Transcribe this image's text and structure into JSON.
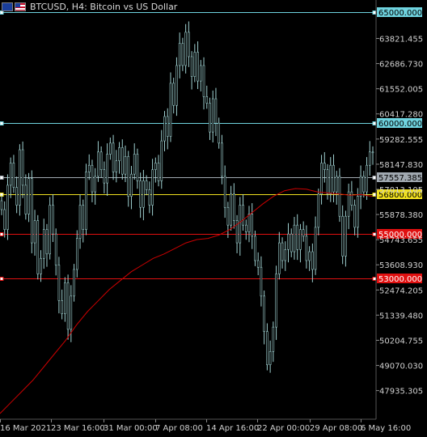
{
  "header": {
    "title": "BTCUSD, H4:  Bitcoin vs US Dollar",
    "flags": [
      "eu-flag-icon",
      "us-flag-icon"
    ]
  },
  "colors": {
    "background": "#000000",
    "candle": "#9fd0d0",
    "moving_average": "#cc0000",
    "level_cyan": "#6fd3df",
    "level_red": "#e01010",
    "level_yellow": "#f0e020",
    "bid_line": "#a0a8b0"
  },
  "chart_data": {
    "type": "line",
    "symbol": "BTCUSD",
    "timeframe": "H4",
    "price_axis_ticks": [
      "63821.455",
      "62686.730",
      "61552.005",
      "60417.280",
      "59282.555",
      "58147.830",
      "57013.105",
      "55878.380",
      "54743.655",
      "53608.930",
      "52474.205",
      "51339.480",
      "50204.755",
      "49070.030",
      "47935.305"
    ],
    "time_axis_ticks": [
      "16 Mar 2021",
      "23 Mar 16:00",
      "31 Mar 00:00",
      "7 Apr 08:00",
      "14 Apr 16:00",
      "22 Apr 00:00",
      "29 Apr 08:00",
      "6 May 16:00"
    ],
    "ylim": [
      46900,
      65300
    ],
    "horizontal_levels": [
      {
        "price": 65000,
        "label": "65000.000",
        "color": "#6fd3df"
      },
      {
        "price": 60000,
        "label": "60000.000",
        "color": "#6fd3df"
      },
      {
        "price": 57557.385,
        "label": "57557.385",
        "color": "#a0a8b0"
      },
      {
        "price": 56800,
        "label": "56800.000",
        "color": "#f0e020"
      },
      {
        "price": 55000,
        "label": "55000.000",
        "color": "#e01010"
      },
      {
        "price": 53000,
        "label": "53000.000",
        "color": "#e01010"
      }
    ],
    "price_series": [
      56500,
      56100,
      55200,
      57200,
      58200,
      57100,
      56300,
      58800,
      57200,
      55900,
      57500,
      54600,
      55600,
      53200,
      53900,
      55200,
      54100,
      56300,
      55000,
      53600,
      52000,
      51400,
      52800,
      50700,
      52200,
      53400,
      54800,
      56300,
      55200,
      57800,
      58100,
      56900,
      57600,
      58700,
      57900,
      57300,
      58600,
      59100,
      57800,
      58300,
      58900,
      57700,
      58500,
      56700,
      57700,
      58600,
      57400,
      56200,
      57400,
      57000,
      56300,
      57900,
      58200,
      57400,
      59200,
      60300,
      59400,
      61800,
      60800,
      62600,
      63600,
      62600,
      64100,
      63000,
      62100,
      63200,
      61900,
      62600,
      61200,
      60900,
      59600,
      61100,
      60000,
      59100,
      57600,
      56200,
      55400,
      56800,
      55600,
      54600,
      56300,
      55400,
      55100,
      55900,
      54900,
      53800,
      53500,
      52200,
      50600,
      49100,
      49700,
      50800,
      53200,
      54600,
      53800,
      54300,
      55000,
      54200,
      55400,
      54300,
      55200,
      54900,
      53800,
      54200,
      53400,
      55300,
      56800,
      58200,
      57900,
      56800,
      58100,
      56900,
      57600,
      55800,
      54000,
      55800,
      56900,
      56300,
      55300,
      56700,
      57600,
      56900,
      58100,
      58700
    ],
    "moving_average": [
      46900,
      47400,
      47900,
      48400,
      49000,
      49600,
      50200,
      50900,
      51500,
      52000,
      52500,
      52900,
      53300,
      53600,
      53900,
      54100,
      54350,
      54600,
      54750,
      54800,
      54950,
      55200,
      55550,
      55950,
      56350,
      56700,
      56950,
      57050,
      57020,
      56900,
      56850,
      56800,
      56750,
      56780,
      56700
    ]
  }
}
